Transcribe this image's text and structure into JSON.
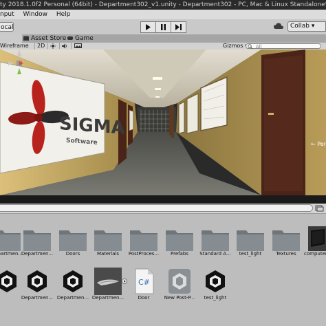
{
  "window": {
    "title": "ty 2018.1.0f2 Personal (64bit) - Department302_v1.unity - Department302 - PC, Mac & Linux Standalone* <DX"
  },
  "menu": [
    "nput",
    "Window",
    "Help"
  ],
  "toolbar": {
    "left_label": "ocal",
    "collab_label": "Collab ▾"
  },
  "tabs": [
    {
      "label": "",
      "icon": "scene-icon",
      "active": true
    },
    {
      "label": "Asset Store",
      "icon": "asset-store-icon",
      "active": false
    },
    {
      "label": "Game",
      "icon": "game-icon",
      "active": false
    }
  ],
  "scene_toolbar": {
    "render_mode": "Wireframe",
    "mode_2d": "2D",
    "gizmos": "Gizmos ▾",
    "search_placeholder": "All"
  },
  "scene": {
    "logo_text": "SIGMA",
    "logo_sub": "Software",
    "persp_label": "← Per"
  },
  "assets_row1": [
    {
      "name": "Departmen...",
      "type": "folder"
    },
    {
      "name": "Departmen...",
      "type": "folder"
    },
    {
      "name": "Doors",
      "type": "folder"
    },
    {
      "name": "Materials",
      "type": "folder"
    },
    {
      "name": "PostProces...",
      "type": "folder"
    },
    {
      "name": "Prefabs",
      "type": "folder"
    },
    {
      "name": "Standard A...",
      "type": "folder"
    },
    {
      "name": "test_light",
      "type": "folder"
    },
    {
      "name": "Textures",
      "type": "folder"
    },
    {
      "name": "computer",
      "type": "model"
    }
  ],
  "assets_row2": [
    {
      "name": "",
      "type": "unity"
    },
    {
      "name": "Departmen...",
      "type": "unity"
    },
    {
      "name": "Departmen...",
      "type": "unity"
    },
    {
      "name": "Departmen...",
      "type": "mesh"
    },
    {
      "name": "Door",
      "type": "script",
      "glyph": "C#"
    },
    {
      "name": "New Post-P...",
      "type": "postprocess"
    },
    {
      "name": "test_light",
      "type": "unity"
    }
  ],
  "colors": {
    "wall": "#c9a85a",
    "ceiling": "#d8d4c6",
    "door": "#4a2418",
    "floor": "#6d6d66",
    "logo_red": "#b8231d"
  }
}
